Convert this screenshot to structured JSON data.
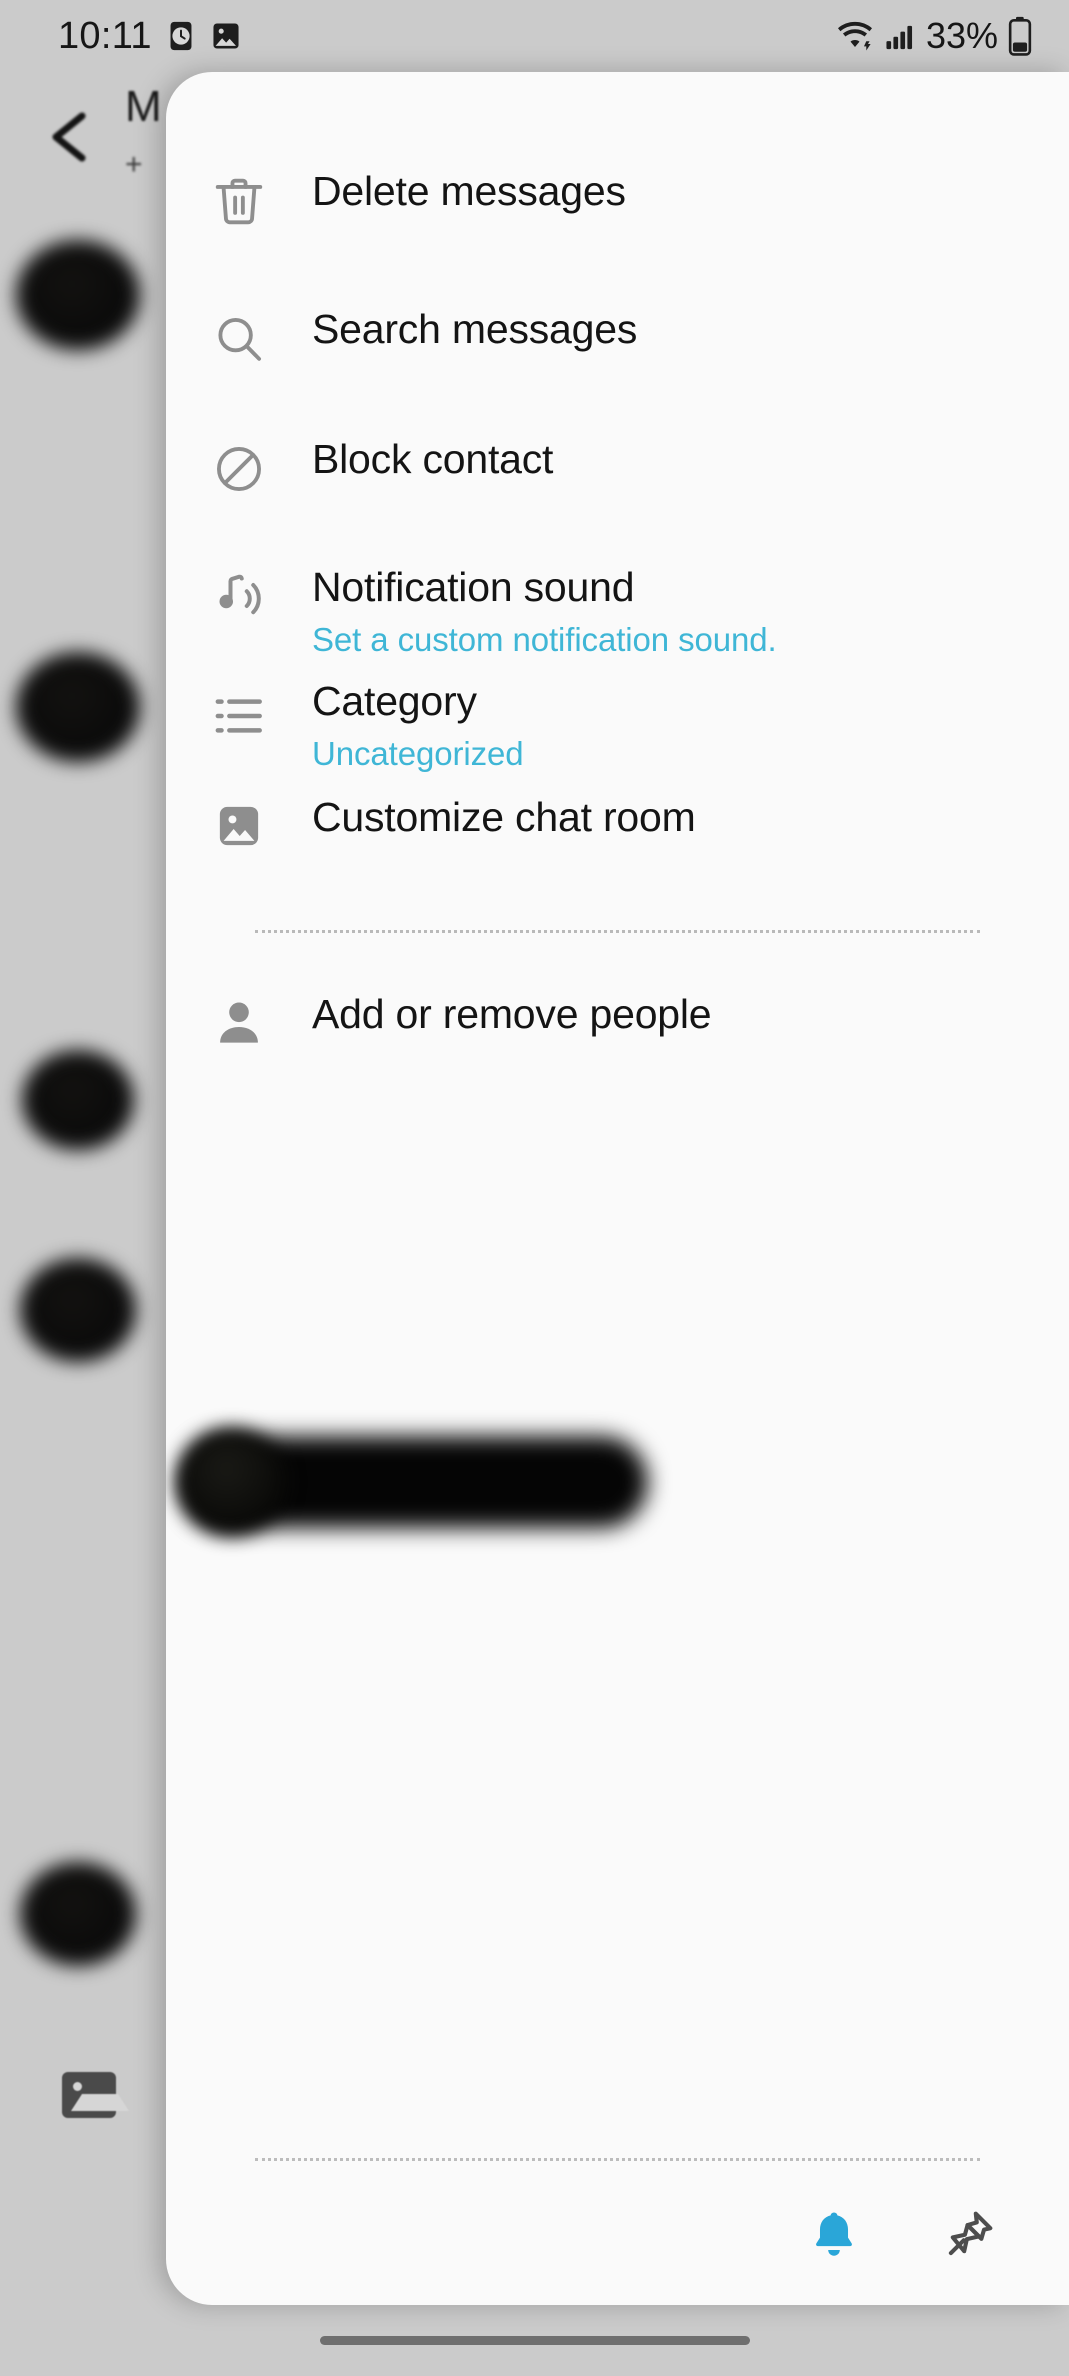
{
  "status_bar": {
    "time": "10:11",
    "left_icons": [
      "alarm-clock-icon",
      "gallery-icon"
    ],
    "wifi_icon": "wifi-icon",
    "signal_icon": "cellular-signal-icon",
    "battery_percent": "33%",
    "battery_icon": "battery-icon"
  },
  "background": {
    "back_label": "<",
    "title": "M",
    "subtitle": "+",
    "photo_icon": "gallery-placeholder-icon"
  },
  "menu": {
    "items": [
      {
        "icon": "trash-icon",
        "label": "Delete messages",
        "sub": ""
      },
      {
        "icon": "search-icon",
        "label": "Search messages",
        "sub": ""
      },
      {
        "icon": "block-icon",
        "label": "Block contact",
        "sub": ""
      },
      {
        "icon": "music-note-icon",
        "label": "Notification sound",
        "sub": "Set a custom notification sound."
      },
      {
        "icon": "list-icon",
        "label": "Category",
        "sub": "Uncategorized"
      },
      {
        "icon": "image-icon",
        "label": "Customize chat room",
        "sub": ""
      }
    ],
    "people_item": {
      "icon": "person-icon",
      "label": "Add or remove people"
    }
  },
  "bottom_bar": {
    "actions": [
      {
        "icon": "bell-icon",
        "name": "notifications-toggle",
        "color": "#2aa6d8",
        "active": true
      },
      {
        "icon": "pin-icon",
        "name": "pin-chat-toggle",
        "color": "#4d4d4d",
        "active": false
      }
    ]
  },
  "colors": {
    "accent_blue": "#3fb6d6",
    "bell_blue": "#2aa6d8",
    "sheet_bg": "#fafafa",
    "backdrop": "#cbcbcb",
    "icon_gray": "#8e8e8e",
    "text_primary": "#141414"
  }
}
